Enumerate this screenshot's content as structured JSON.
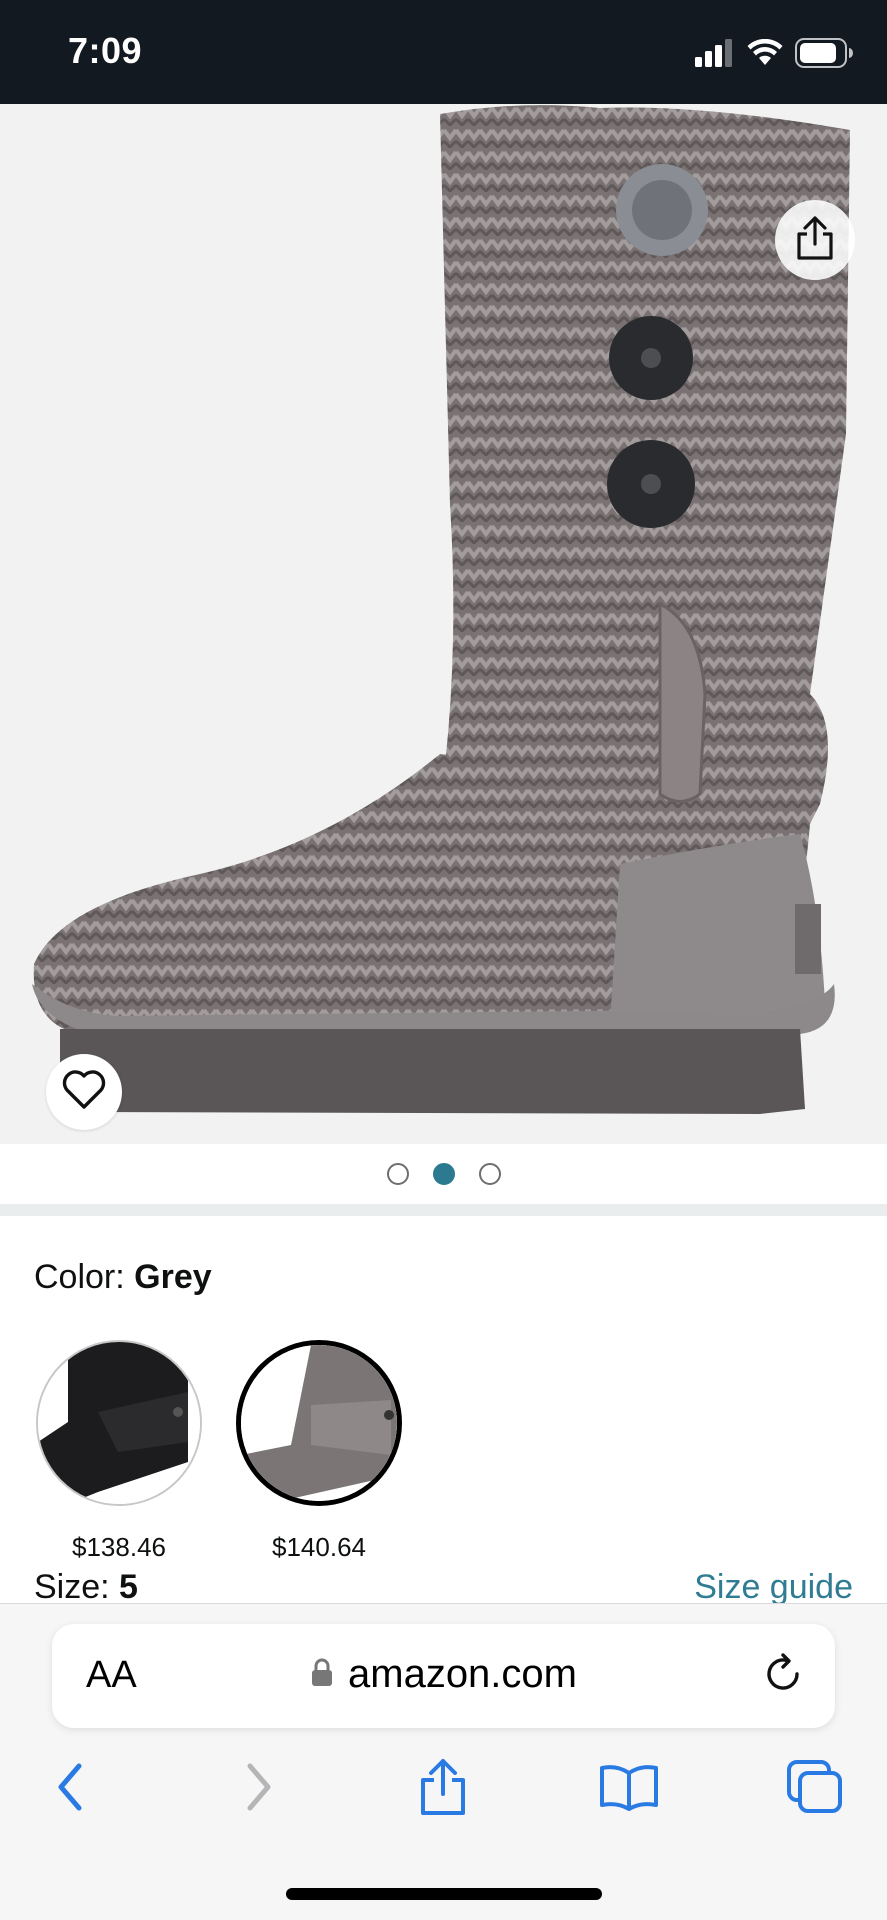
{
  "status_bar": {
    "time": "7:09"
  },
  "product": {
    "gallery_dots": [
      false,
      true,
      false
    ],
    "color_prefix": "Color:",
    "color_value": "Grey",
    "swatches": [
      {
        "price": "$138.46",
        "color": "#1c1c1e"
      },
      {
        "price": "$140.64",
        "color": "#7c7575"
      }
    ],
    "size_prefix": "Size:",
    "size_value": "5",
    "size_guide": "Size guide"
  },
  "browser": {
    "text_size_label": "AA",
    "url": "amazon.com"
  },
  "colors": {
    "status_bar_bg": "#131921",
    "link": "#2f7c93",
    "ios_blue": "#2a7ae4",
    "active_dot": "#2b7a8f"
  }
}
